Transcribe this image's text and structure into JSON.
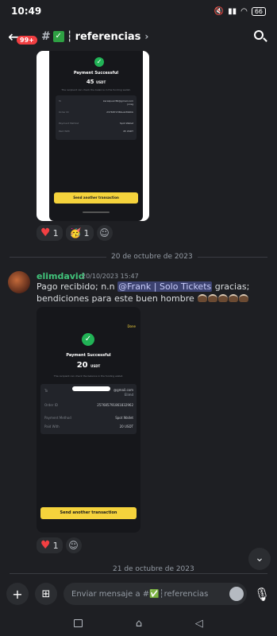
{
  "status": {
    "time": "10:49",
    "battery": "66"
  },
  "header": {
    "badge": "99+",
    "channel_name": "referencias"
  },
  "screenshot1": {
    "title": "Payment Successful",
    "amount": "45",
    "unit": "USDT",
    "note": "The recipient can check the balance in the funding wallet.",
    "rows": [
      {
        "label": "To",
        "value": "keralquarr86@gmail.com jorag"
      },
      {
        "label": "Order ID",
        "value": "2376871786so4399hb"
      },
      {
        "label": "Payment Method",
        "value": "Spot Wallet"
      },
      {
        "label": "Paid With",
        "value": "45 USDT"
      }
    ],
    "button": "Send another transaction"
  },
  "reactions1": [
    {
      "emoji": "heart",
      "count": "1"
    },
    {
      "emoji": "party-face",
      "count": "1"
    }
  ],
  "divider1": "20 de octubre de 2023",
  "message": {
    "author": "elimdavid",
    "timestamp": "20/10/2023 15:47",
    "text_before": "Pago recibido; n.n ",
    "mention": "@Frank | Solo Tickets",
    "text_after": " gracias; bendiciones para este buen hombre"
  },
  "screenshot2": {
    "done": "Done",
    "title": "Payment Successful",
    "amount": "20",
    "unit": "USDT",
    "note": "The recipient can check the balance in the funding wallet.",
    "to_label": "To",
    "to_value": "@gmail.com",
    "to_name": "Elimd",
    "order_label": "Order ID",
    "order_value": "257685791861832962",
    "method_label": "Payment Method",
    "method_value": "Spot Wallet",
    "paid_label": "Paid With",
    "paid_value": "20 USDT",
    "button": "Send another transaction"
  },
  "reactions2": [
    {
      "emoji": "heart",
      "count": "1"
    }
  ],
  "divider2": "21 de octubre de 2023",
  "composer": {
    "placeholder": "Enviar mensaje a #✅┆referencias"
  },
  "colors": {
    "background": "#1e1f23",
    "accent_yellow": "#f5d33c",
    "success_green": "#21b356",
    "mention_bg": "#3c4270",
    "author_green": "#41c37a"
  }
}
